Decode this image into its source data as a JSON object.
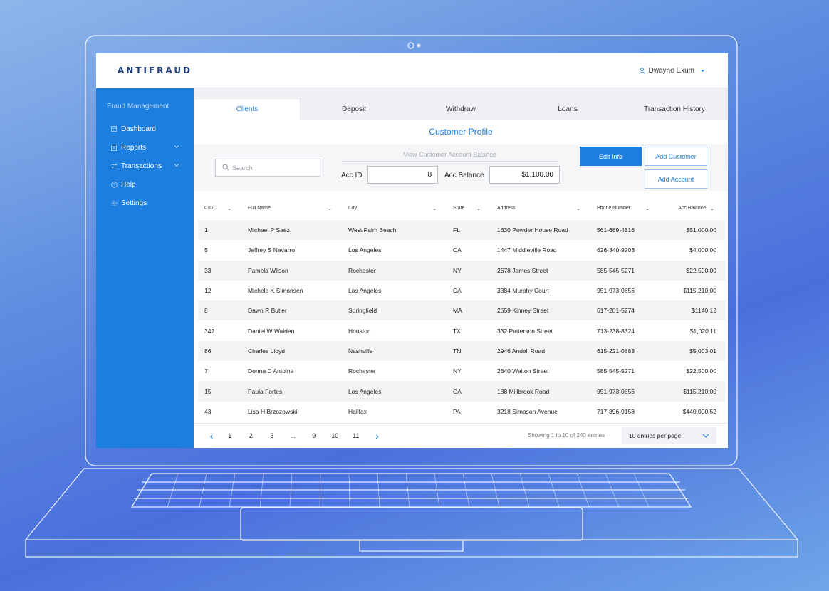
{
  "app": {
    "logo": "ANTIFRAUD",
    "user_name": "Dwayne Exum"
  },
  "sidebar": {
    "title": "Fraud Management",
    "items": [
      {
        "label": "Dashboard",
        "icon": "dashboard-icon"
      },
      {
        "label": "Reports",
        "icon": "document-icon",
        "has_submenu": true
      },
      {
        "label": "Transactions",
        "icon": "transfer-icon",
        "has_submenu": true
      },
      {
        "label": "Help",
        "icon": "help-icon"
      },
      {
        "label": "Settings",
        "icon": "gear-icon"
      }
    ]
  },
  "tabs": [
    {
      "label": "Clients",
      "active": true
    },
    {
      "label": "Deposit",
      "active": false
    },
    {
      "label": "Withdraw",
      "active": false
    },
    {
      "label": "Loans",
      "active": false
    },
    {
      "label": "Transaction History",
      "active": false
    }
  ],
  "profile": {
    "title": "Customer Profile",
    "search_placeholder": "Search",
    "view_balance_label": "View Customer Account Balance",
    "acc_id_label": "Acc ID",
    "acc_id_value": "8",
    "acc_balance_label": "Acc Balance",
    "acc_balance_value": "$1,100.00",
    "edit_info_label": "Edit Info",
    "add_customer_label": "Add Customer",
    "add_account_label": "Add Account"
  },
  "table": {
    "headers": [
      "CID",
      "Full Name",
      "City",
      "State",
      "Address",
      "Phone Number",
      "Acc Balance"
    ],
    "rows": [
      [
        "1",
        "Michael P Saez",
        "West Palm Beach",
        "FL",
        "1630 Powder House Road",
        "561-689-4816",
        "$51,000.00"
      ],
      [
        "5",
        "Jeffrey S Navarro",
        "Los Angeles",
        "CA",
        "1447 Middleville Road",
        "626-340-9203",
        "$4,000.00"
      ],
      [
        "33",
        "Pamela Wilson",
        "Rochester",
        "NY",
        "2678 James Street",
        "585-545-5271",
        "$22,500.00"
      ],
      [
        "12",
        "Michela K Simonsen",
        "Los Angeles",
        "CA",
        "3384 Murphy Court",
        "951-973-0856",
        "$115,210.00"
      ],
      [
        "8",
        "Dawn R Butler",
        "Springfield",
        "MA",
        "2659 Kinney Street",
        "617-201-5274",
        "$1140.12"
      ],
      [
        "342",
        "Daniel W Walden",
        "Houston",
        "TX",
        "332 Patterson Street",
        "713-238-8324",
        "$1,020.11"
      ],
      [
        "86",
        "Charles Lloyd",
        "Nashville",
        "TN",
        "2946 Andell Road",
        "615-221-0883",
        "$5,003.01"
      ],
      [
        "7",
        "Donna D Antoine",
        "Rochester",
        "NY",
        "2640 Walton Street",
        "585-545-5271",
        "$22,500.00"
      ],
      [
        "15",
        "Paula Fortes",
        "Los Angeles",
        "CA",
        "188 Millbrook Road",
        "951-973-0856",
        "$115,210.00"
      ],
      [
        "43",
        "Lisa H Brzozowski",
        "Halifax",
        "PA",
        "3218 Simpson Avenue",
        "717-896-9153",
        "$440,000.52"
      ]
    ]
  },
  "pagination": {
    "pages": [
      "1",
      "2",
      "3",
      "...",
      "9",
      "10",
      "11"
    ],
    "prev": "‹",
    "next": "›",
    "entries_info": "Showing 1 to 10 of 240 entries",
    "per_page": "10 entries per page"
  },
  "colors": {
    "accent": "#1c7fe0",
    "logo": "#1b3d7a"
  }
}
